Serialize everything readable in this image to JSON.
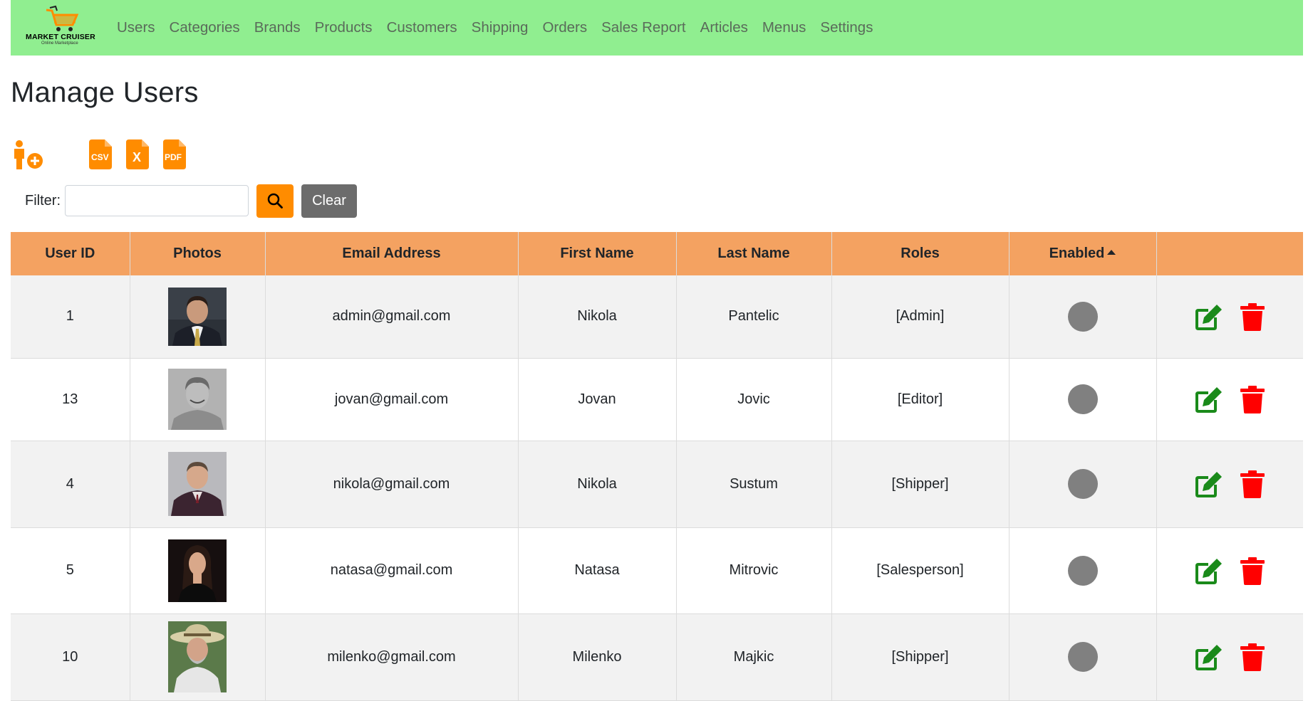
{
  "brand": {
    "name": "MARKET CRUISER",
    "tagline": "Online Marketplace"
  },
  "nav": [
    "Users",
    "Categories",
    "Brands",
    "Products",
    "Customers",
    "Shipping",
    "Orders",
    "Sales Report",
    "Articles",
    "Menus",
    "Settings"
  ],
  "page": {
    "title": "Manage Users"
  },
  "toolbar": {
    "csv_label": "CSV",
    "excel_label": "X",
    "pdf_label": "PDF"
  },
  "filter": {
    "label": "Filter:",
    "value": "",
    "placeholder": "",
    "clear_label": "Clear"
  },
  "table": {
    "headers": [
      "User ID",
      "Photos",
      "Email Address",
      "First Name",
      "Last Name",
      "Roles",
      "Enabled",
      ""
    ],
    "rows": [
      {
        "id": "1",
        "email": "admin@gmail.com",
        "first": "Nikola",
        "last": "Pantelic",
        "roles": "[Admin]"
      },
      {
        "id": "13",
        "email": "jovan@gmail.com",
        "first": "Jovan",
        "last": "Jovic",
        "roles": "[Editor]"
      },
      {
        "id": "4",
        "email": "nikola@gmail.com",
        "first": "Nikola",
        "last": "Sustum",
        "roles": "[Shipper]"
      },
      {
        "id": "5",
        "email": "natasa@gmail.com",
        "first": "Natasa",
        "last": "Mitrovic",
        "roles": "[Salesperson]"
      },
      {
        "id": "10",
        "email": "milenko@gmail.com",
        "first": "Milenko",
        "last": "Majkic",
        "roles": "[Shipper]"
      }
    ]
  },
  "colors": {
    "navbar": "#90ee90",
    "accent": "#ff8c00",
    "table_header": "#f4a261",
    "edit": "#1a8a1a",
    "delete": "#ff0000",
    "enabled_dot": "#808080"
  }
}
